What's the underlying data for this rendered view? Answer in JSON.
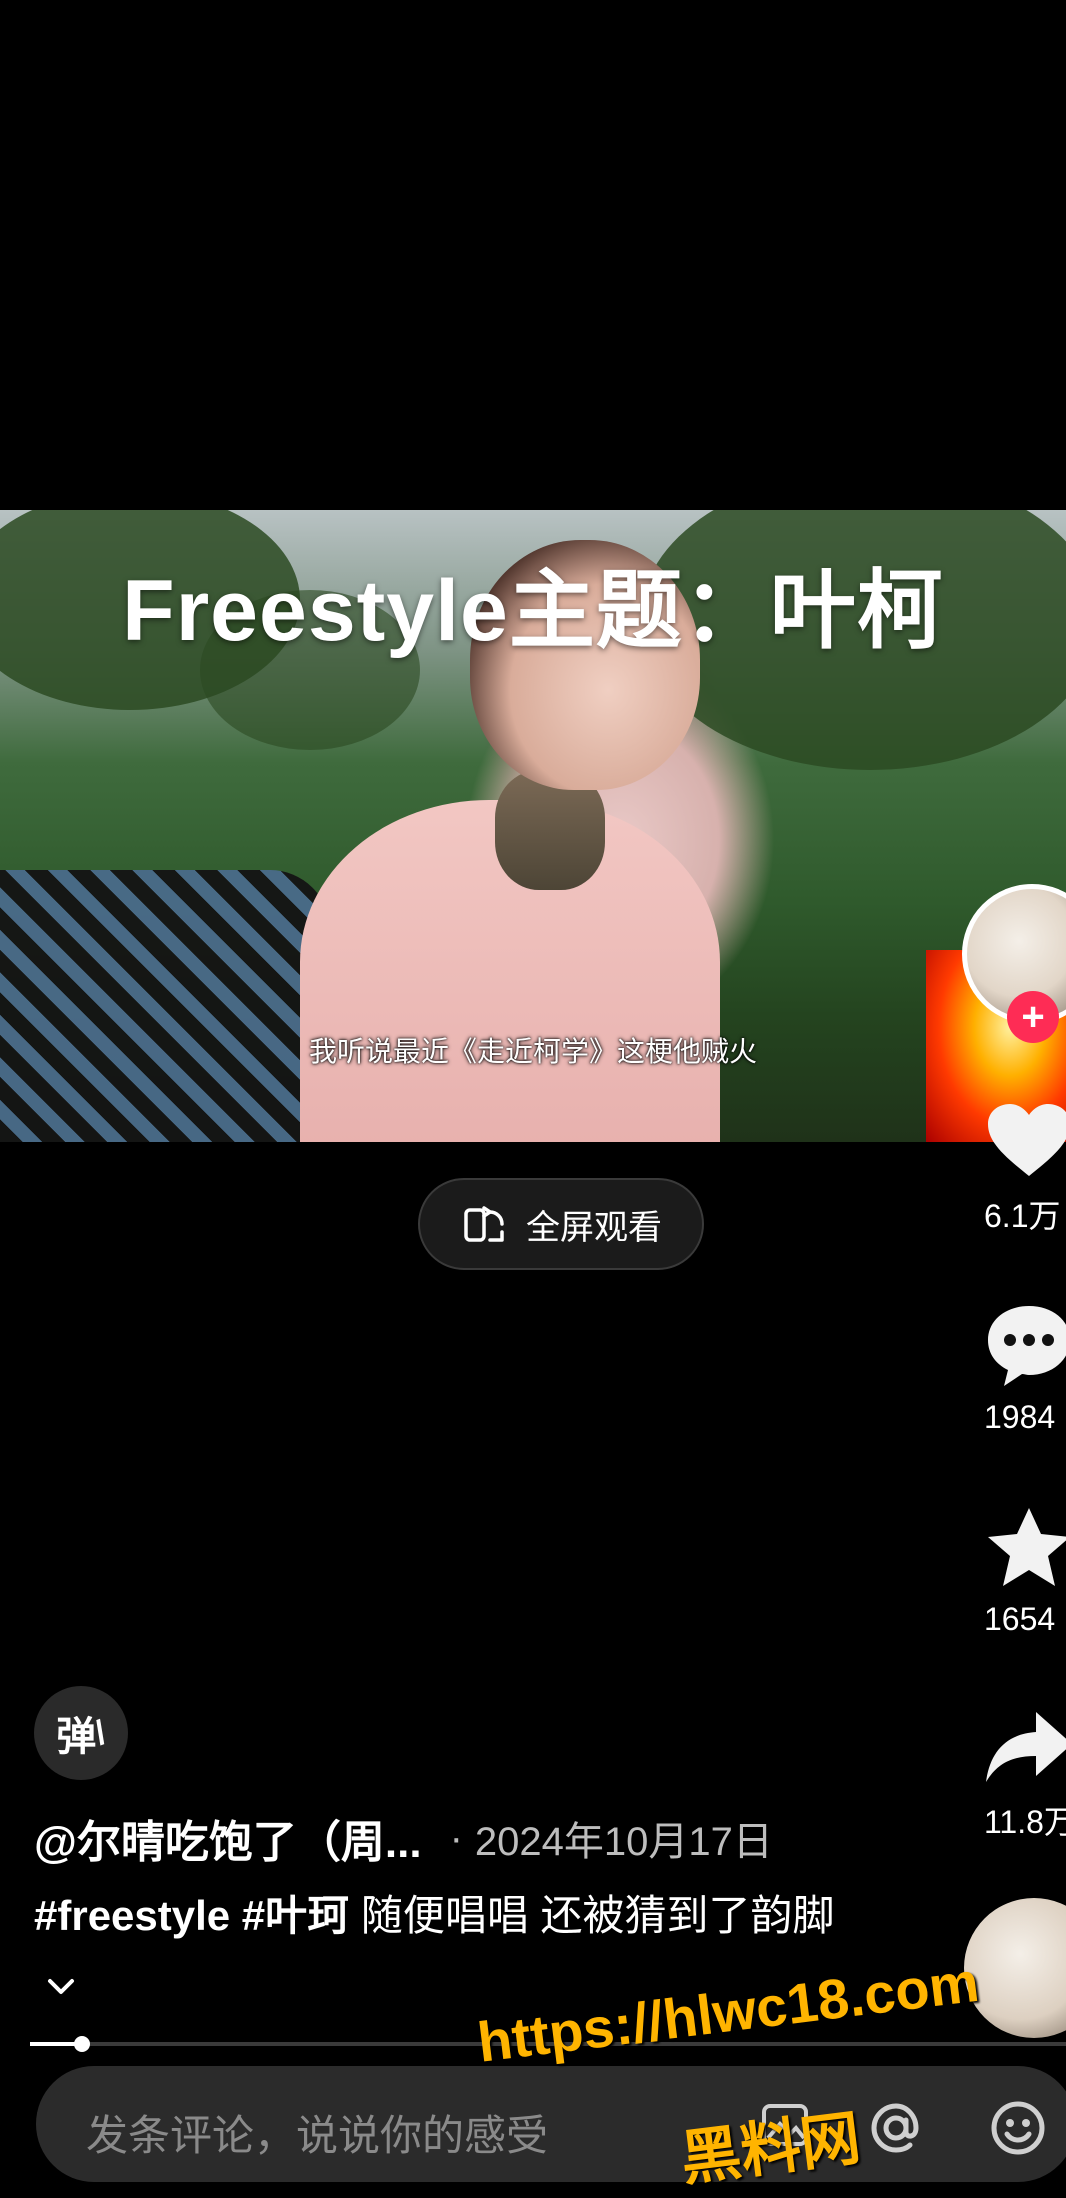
{
  "video": {
    "title_overlay": "Freestyle主题：叶柯",
    "subtitle": "我听说最近《走近柯学》这梗他贼火"
  },
  "fullscreen_button": {
    "label": "全屏观看"
  },
  "rail": {
    "like_count": "6.1万",
    "comment_count": "1984",
    "favorite_count": "1654",
    "share_count": "11.8万"
  },
  "danmu_button": {
    "label": "弹"
  },
  "post": {
    "author": "@尔晴吃饱了（周...",
    "date_separator": "·",
    "date": "2024年10月17日",
    "tags": "#freestyle #叶珂",
    "description": "随便唱唱 还被猜到了韵脚"
  },
  "progress": {
    "fraction": 0.05
  },
  "comment_bar": {
    "placeholder": "发条评论，说说你的感受"
  },
  "watermark": {
    "url": "https://hlwc18.com",
    "name": "黑料网"
  },
  "colors": {
    "accent": "#fe2c55",
    "background": "#000000",
    "watermark": "#ffb400"
  }
}
